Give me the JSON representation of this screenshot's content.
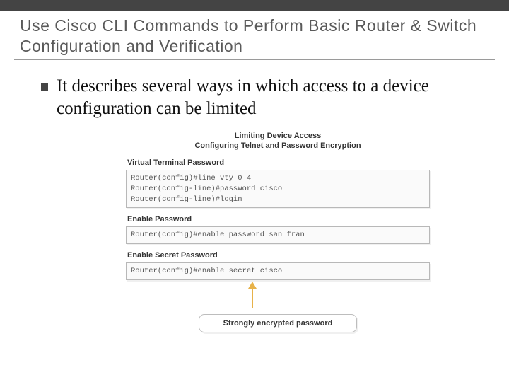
{
  "title": "Use Cisco CLI Commands to Perform Basic Router & Switch Configuration and Verification",
  "bullet": "It describes several ways in which access to a device configuration can be limited",
  "diagram": {
    "heading_line1": "Limiting Device Access",
    "heading_line2": "Configuring Telnet and Password Encryption",
    "sections": {
      "vty": {
        "label": "Virtual Terminal Password",
        "line1": "Router(config)#line vty 0 4",
        "line2": "Router(config-line)#password cisco",
        "line3": "Router(config-line)#login"
      },
      "enable_pw": {
        "label": "Enable Password",
        "line1": "Router(config)#enable password san fran"
      },
      "enable_secret": {
        "label": "Enable Secret Password",
        "line1": "Router(config)#enable secret cisco"
      }
    },
    "callout": "Strongly encrypted password"
  }
}
